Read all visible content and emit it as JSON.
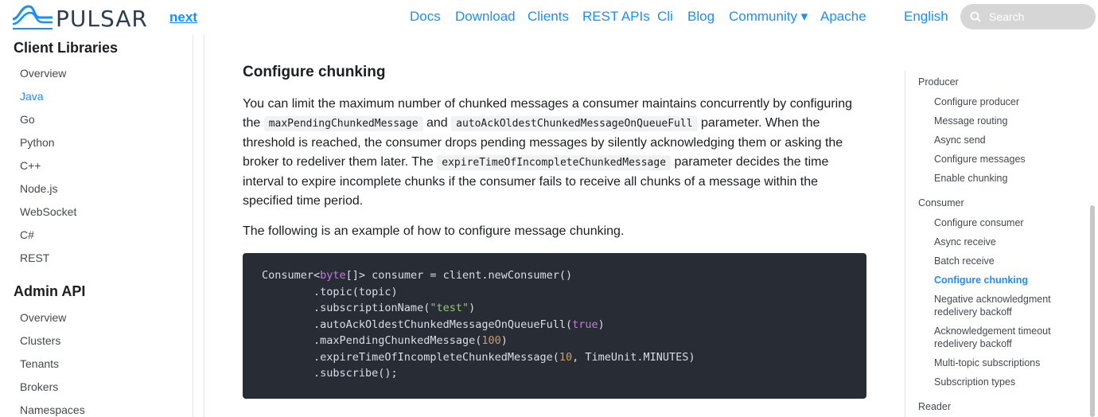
{
  "header": {
    "brand": "PULSAR",
    "version": "next",
    "nav": [
      "Docs",
      "Download",
      "Clients",
      "REST APIs",
      "Cli",
      "Blog",
      "Community ▾",
      "Apache",
      "English"
    ],
    "search_placeholder": "Search"
  },
  "sidebar": {
    "sections": [
      {
        "title": "Client Libraries",
        "items": [
          "Overview",
          "Java",
          "Go",
          "Python",
          "C++",
          "Node.js",
          "WebSocket",
          "C#",
          "REST"
        ]
      },
      {
        "title": "Admin API",
        "items": [
          "Overview",
          "Clusters",
          "Tenants",
          "Brokers",
          "Namespaces"
        ]
      }
    ],
    "active_item": "Java"
  },
  "main": {
    "heading": "Configure chunking",
    "p1": {
      "t1": "You can limit the maximum number of chunked messages a consumer maintains concurrently by configuring the ",
      "c1": "maxPendingChunkedMessage",
      "t2": " and ",
      "c2": "autoAckOldestChunkedMessageOnQueueFull",
      "t3": " parameter. When the threshold is reached, the consumer drops pending messages by silently acknowledging them or asking the broker to redeliver them later. The ",
      "c3": "expireTimeOfIncompleteChunkedMessage",
      "t4": " parameter decides the time interval to expire incomplete chunks if the consumer fails to receive all chunks of a message within the specified time period."
    },
    "p2": "The following is an example of how to configure message chunking.",
    "code": {
      "l1a": "Consumer<",
      "l1b": "byte",
      "l1c": "[]> consumer = client.newConsumer()",
      "l2": "        .topic(topic)",
      "l3a": "        .subscriptionName(",
      "l3b": "\"test\"",
      "l3c": ")",
      "l4a": "        .autoAckOldestChunkedMessageOnQueueFull(",
      "l4b": "true",
      "l4c": ")",
      "l5a": "        .maxPendingChunkedMessage(",
      "l5b": "100",
      "l5c": ")",
      "l6a": "        .expireTimeOfIncompleteChunkedMessage(",
      "l6b": "10",
      "l6c": ", TimeUnit.MINUTES)",
      "l7": "        .subscribe();"
    }
  },
  "toc": {
    "groups": [
      {
        "title": "Producer",
        "items": [
          "Configure producer",
          "Message routing",
          "Async send",
          "Configure messages",
          "Enable chunking"
        ]
      },
      {
        "title": "Consumer",
        "items": [
          "Configure consumer",
          "Async receive",
          "Batch receive",
          "Configure chunking",
          "Negative acknowledgment redelivery backoff",
          "Acknowledgement timeout redelivery backoff",
          "Multi-topic subscriptions",
          "Subscription types"
        ]
      },
      {
        "title": "Reader",
        "items": []
      }
    ],
    "active_item": "Configure chunking"
  },
  "colors": {
    "link": "#188fff",
    "code_bg": "#282c34",
    "text": "#1c1e21"
  }
}
